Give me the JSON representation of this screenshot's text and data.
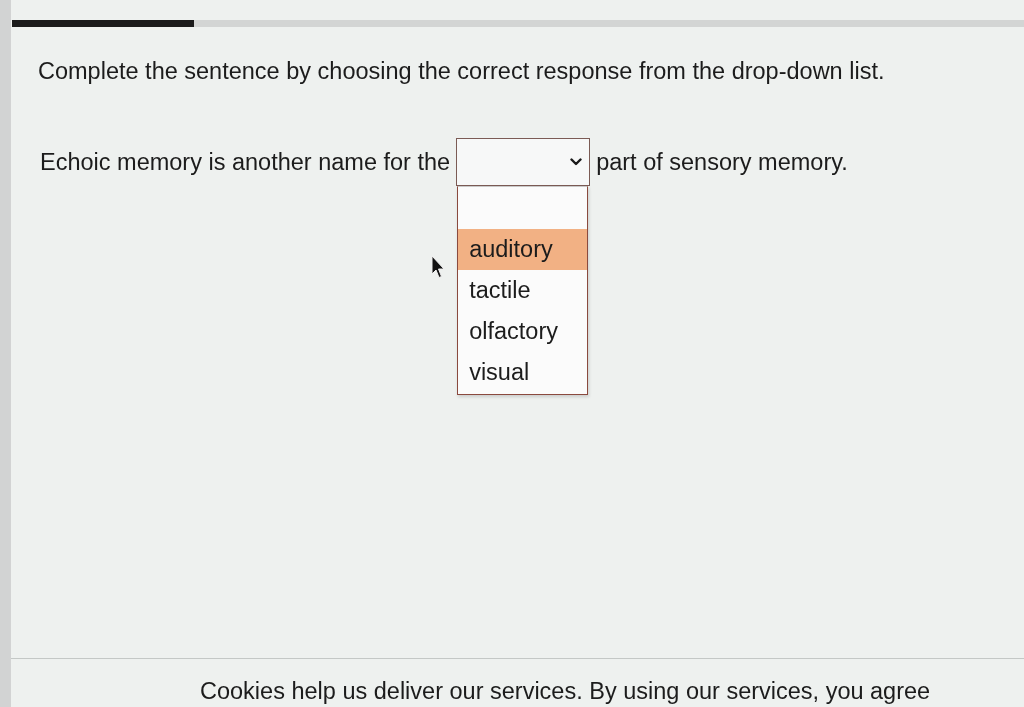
{
  "progress": {
    "level": 0.18
  },
  "instruction": "Complete the sentence by choosing the correct response from the drop-down list.",
  "sentence": {
    "before": "Echoic memory is another name for the",
    "after": "part of sensory memory."
  },
  "dropdown": {
    "expanded": true,
    "options": [
      {
        "label": "auditory",
        "selected": true
      },
      {
        "label": "tactile",
        "selected": false
      },
      {
        "label": "olfactory",
        "selected": false
      },
      {
        "label": "visual",
        "selected": false
      }
    ]
  },
  "cookie_notice": "Cookies help us deliver our services. By using our services, you agree"
}
